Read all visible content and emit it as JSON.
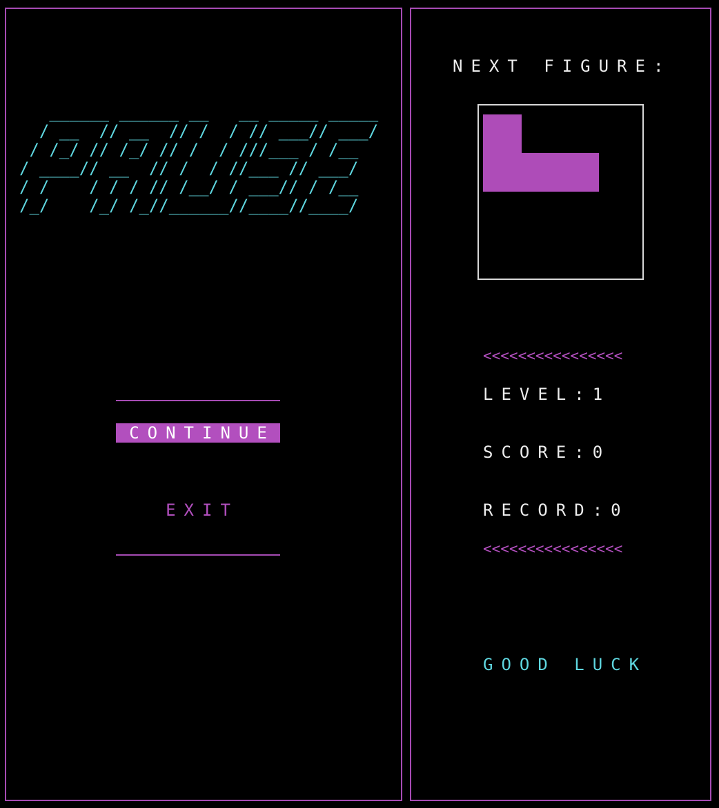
{
  "pause_screen": {
    "banner_ascii": "   ______ ______ __   __ _____ _____\n  / __  // __  // /  / // ___// ___/\n / /_/ // /_/ // /  / ///___ / /__\n/ ____// __  // /  / //___ // ___/\n/ /    / / / // /__/ / ___// / /__\n/_/    /_/ /_//______//____//____/",
    "menu": {
      "continue_label": "CONTINUE",
      "exit_label": "EXIT",
      "selected": "CONTINUE"
    }
  },
  "sidebar": {
    "next_figure_title": "NEXT FIGURE:",
    "next_figure_shape": "L",
    "divider_text": "<<<<<<<<<<<<<<<<",
    "level_text": "LEVEL:1",
    "score_text": "SCORE:0",
    "record_text": "RECORD:0",
    "good_luck_text": "GOOD LUCK"
  },
  "colors": {
    "accent": "#b24fbe",
    "title_cyan": "#5fd7e0",
    "text": "#ececec",
    "background": "#000000"
  }
}
